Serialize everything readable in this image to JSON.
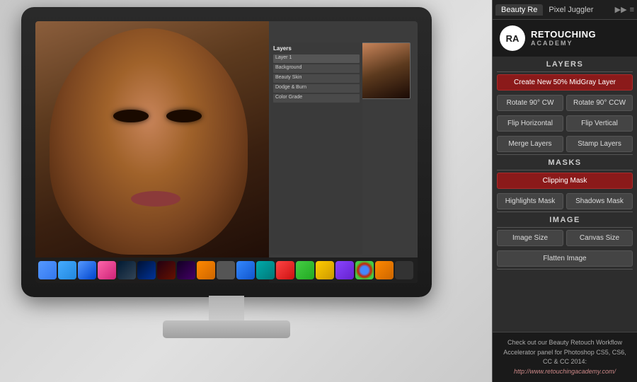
{
  "monitor": {
    "screen_label": "Photoshop screen",
    "taskbar_alt": "macOS dock"
  },
  "panel": {
    "tabs": [
      {
        "label": "Beauty Re",
        "active": true
      },
      {
        "label": "Pixel Juggler",
        "active": false
      }
    ],
    "tab_arrows": "▶▶",
    "tab_menu": "≡",
    "logo": {
      "initials": "RA",
      "line1": "RETOUCHING",
      "line2": "ACADEMY"
    },
    "sections": {
      "layers": {
        "header": "LAYERS",
        "btn_midgray": "Create New 50% MidGray Layer",
        "btn_rotate_cw": "Rotate 90° CW",
        "btn_rotate_ccw": "Rotate 90° CCW",
        "btn_flip_h": "Flip Horizontal",
        "btn_flip_v": "Flip Vertical",
        "btn_merge": "Merge Layers",
        "btn_stamp": "Stamp Layers"
      },
      "masks": {
        "header": "MASKS",
        "btn_clipping": "Clipping Mask",
        "btn_highlights": "Highlights Mask",
        "btn_shadows": "Shadows Mask"
      },
      "image": {
        "header": "IMAGE",
        "btn_image_size": "Image Size",
        "btn_canvas_size": "Canvas Size",
        "btn_flatten": "Flatten Image"
      }
    },
    "footer": {
      "line1": "Check out our Beauty Retouch Workflow",
      "line2": "Accelerator panel for Photoshop CS5, CS6,",
      "line3": "CC & CC 2014:",
      "link": "http://www.retouchingacademy.com/"
    }
  }
}
